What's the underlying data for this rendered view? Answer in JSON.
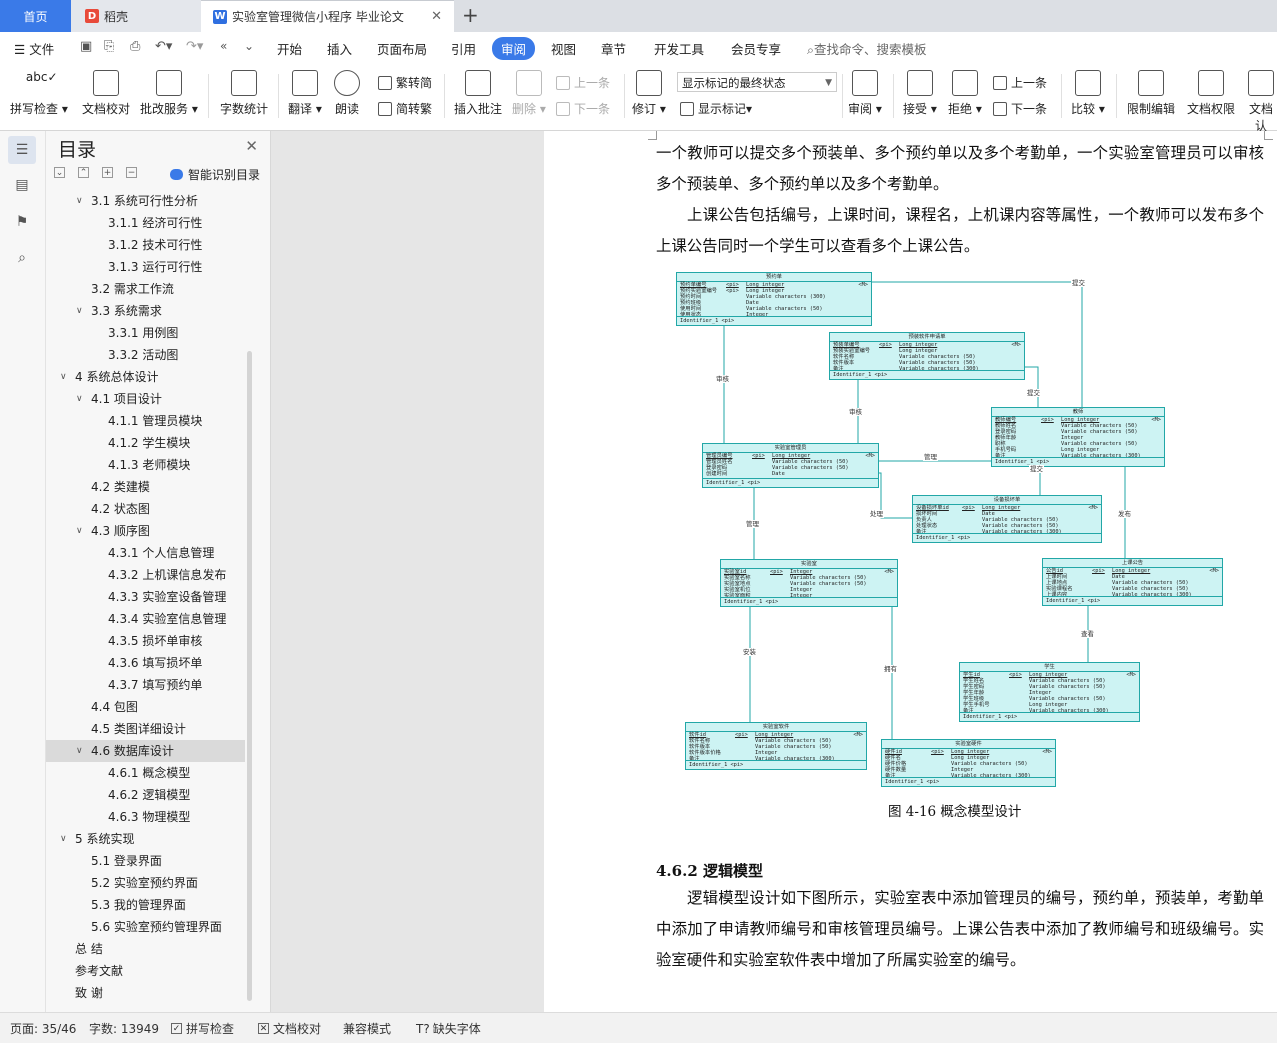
{
  "tabs": {
    "home": "首页",
    "daoke": "稻壳",
    "document": "实验室管理微信小程序 毕业论文"
  },
  "menubar": {
    "file": "文件",
    "items": [
      "开始",
      "插入",
      "页面布局",
      "引用",
      "审阅",
      "视图",
      "章节",
      "开发工具",
      "会员专享"
    ],
    "search_placeholder": "查找命令、搜索模板"
  },
  "ribbon": {
    "spell_check": "拼写检查",
    "doc_proof": "文档校对",
    "batch_service": "批改服务",
    "word_count": "字数统计",
    "translate": "翻译",
    "read_aloud": "朗读",
    "to_traditional": "繁转简",
    "to_simplified": "简转繁",
    "insert_comment": "插入批注",
    "delete": "删除",
    "prev_comment": "上一条",
    "next_comment": "下一条",
    "revise": "修订",
    "markup_mode": "显示标记的最终状态",
    "show_markup": "显示标记",
    "review": "审阅",
    "accept": "接受",
    "reject": "拒绝",
    "prev_change": "上一条",
    "next_change": "下一条",
    "compare": "比较",
    "restrict_edit": "限制编辑",
    "doc_permission": "文档权限",
    "doc_cert": "文档认"
  },
  "toc": {
    "title": "目录",
    "smart": "智能识别目录",
    "items": [
      {
        "text": "3.1 系统可行性分析",
        "level": 2,
        "expanded": true
      },
      {
        "text": "3.1.1 经济可行性",
        "level": 3
      },
      {
        "text": "3.1.2 技术可行性",
        "level": 3
      },
      {
        "text": "3.1.3 运行可行性",
        "level": 3
      },
      {
        "text": "3.2 需求工作流",
        "level": 2
      },
      {
        "text": "3.3 系统需求",
        "level": 2,
        "expanded": true
      },
      {
        "text": "3.3.1 用例图",
        "level": 3
      },
      {
        "text": "3.3.2 活动图",
        "level": 3
      },
      {
        "text": "4 系统总体设计",
        "level": 1,
        "expanded": true
      },
      {
        "text": "4.1 项目设计",
        "level": 2,
        "expanded": true
      },
      {
        "text": "4.1.1 管理员模块",
        "level": 3
      },
      {
        "text": "4.1.2 学生模块",
        "level": 3
      },
      {
        "text": "4.1.3 老师模块",
        "level": 3
      },
      {
        "text": "4.2 类建模",
        "level": 2
      },
      {
        "text": "4.2  状态图",
        "level": 2
      },
      {
        "text": "4.3  顺序图",
        "level": 2,
        "expanded": true
      },
      {
        "text": "4.3.1 个人信息管理",
        "level": 3
      },
      {
        "text": "4.3.2 上机课信息发布",
        "level": 3
      },
      {
        "text": "4.3.3 实验室设备管理",
        "level": 3
      },
      {
        "text": "4.3.4 实验室信息管理",
        "level": 3
      },
      {
        "text": "4.3.5 损坏单审核",
        "level": 3
      },
      {
        "text": "4.3.6 填写损坏单",
        "level": 3
      },
      {
        "text": "4.3.7 填写预约单",
        "level": 3
      },
      {
        "text": "4.4  包图",
        "level": 2
      },
      {
        "text": "4.5 类图详细设计",
        "level": 2
      },
      {
        "text": "4.6  数据库设计",
        "level": 2,
        "expanded": true,
        "selected": true
      },
      {
        "text": "4.6.1  概念模型",
        "level": 3
      },
      {
        "text": "4.6.2  逻辑模型",
        "level": 3
      },
      {
        "text": "4.6.3  物理模型",
        "level": 3
      },
      {
        "text": "5 系统实现",
        "level": 1,
        "expanded": true
      },
      {
        "text": "5.1 登录界面",
        "level": 2
      },
      {
        "text": "5.2  实验室预约界面",
        "level": 2
      },
      {
        "text": "5.3  我的管理界面",
        "level": 2
      },
      {
        "text": "5.6  实验室预约管理界面",
        "level": 2
      },
      {
        "text": "总   结",
        "level": 1
      },
      {
        "text": "参考文献",
        "level": 1
      },
      {
        "text": "致   谢",
        "level": 1
      }
    ]
  },
  "document": {
    "para1": "一个教师可以提交多个预装单、多个预约单以及多个考勤单，一个实验室管理员可以审核多个预装单、多个预约单以及多个考勤单。",
    "para2": "上课公告包括编号，上课时间，课程名，上机课内容等属性，一个教师可以发布多个上课公告同时一个学生可以查看多个上课公告。",
    "caption": "图 4-16  概念模型设计",
    "heading": "4.6.2  逻辑模型",
    "para3": "逻辑模型设计如下图所示，实验室表中添加管理员的编号，预约单，预装单，考勤单中添加了申请教师编号和审核管理员编号。上课公告表中添加了教师编号和班级编号。实验室硬件和实验室软件表中增加了所属实验室的编号。"
  },
  "er_diagram": {
    "entities": [
      {
        "id": "reservation",
        "title": "预约单",
        "fields": [
          [
            "预约单编号",
            "<pi>",
            "Long integer"
          ],
          [
            "预约实验室编号",
            "<pi>",
            "Long integer"
          ],
          [
            "预约时间",
            "",
            "Variable characters (300)"
          ],
          [
            "预约班级",
            "",
            "Date"
          ],
          [
            "使用时间",
            "",
            "Variable characters (50)"
          ],
          [
            "使用状态",
            "",
            "Integer"
          ]
        ],
        "identifier": "Identifier_1  <pi>",
        "mark": "<M>"
      },
      {
        "id": "preinstall",
        "title": "预装软件申请单",
        "fields": [
          [
            "预装单编号",
            "<pi>",
            "Long integer"
          ],
          [
            "预装实验室编号",
            "",
            "Long integer"
          ],
          [
            "软件名称",
            "",
            "Variable characters (50)"
          ],
          [
            "软件版本",
            "",
            "Variable characters (50)"
          ],
          [
            "备注",
            "",
            "Variable characters (300)"
          ]
        ],
        "identifier": "Identifier_1  <pi>",
        "mark": "<M>"
      },
      {
        "id": "teacher",
        "title": "教师",
        "fields": [
          [
            "教师编号",
            "<pi>",
            "Long integer"
          ],
          [
            "教师姓名",
            "",
            "Variable characters (50)"
          ],
          [
            "登录密码",
            "",
            "Variable characters (50)"
          ],
          [
            "教师年龄",
            "",
            "Integer"
          ],
          [
            "职称",
            "",
            "Variable characters (50)"
          ],
          [
            "手机号码",
            "",
            "Long integer"
          ],
          [
            "备注",
            "",
            "Variable characters (300)"
          ]
        ],
        "identifier": "Identifier_1  <pi>",
        "mark": "<M>"
      },
      {
        "id": "admin",
        "title": "实验室管理员",
        "fields": [
          [
            "管理员编号",
            "<pi>",
            "Long integer"
          ],
          [
            "管理员姓名",
            "",
            "Variable characters (50)"
          ],
          [
            "登录密码",
            "",
            "Variable characters (50)"
          ],
          [
            "创建时间",
            "",
            "Date"
          ]
        ],
        "identifier": "Identifier_1  <pi>",
        "mark": "<M>"
      },
      {
        "id": "damage",
        "title": "设备损坏单",
        "fields": [
          [
            "设备损坏单id",
            "<pi>",
            "Long integer"
          ],
          [
            "损坏时间",
            "",
            "Date"
          ],
          [
            "负责人",
            "",
            "Variable characters (50)"
          ],
          [
            "处理状态",
            "",
            "Variable characters (50)"
          ],
          [
            "备注",
            "",
            "Variable characters (300)"
          ]
        ],
        "identifier": "Identifier_1  <pi>",
        "mark": "<M>"
      },
      {
        "id": "lab",
        "title": "实验室",
        "fields": [
          [
            "实验室id",
            "<pi>",
            "Integer"
          ],
          [
            "实验室名称",
            "",
            "Variable characters (50)"
          ],
          [
            "实验室地点",
            "",
            "Variable characters (50)"
          ],
          [
            "实验室机位",
            "",
            "Integer"
          ],
          [
            "实验室面积",
            "",
            "Integer"
          ]
        ],
        "identifier": "Identifier_1  <pi>",
        "mark": "<M>"
      },
      {
        "id": "notice",
        "title": "上课公告",
        "fields": [
          [
            "公告id",
            "<pi>",
            "Long integer"
          ],
          [
            "上课时间",
            "",
            "Date"
          ],
          [
            "上课地点",
            "",
            "Variable characters (50)"
          ],
          [
            "实验课程名",
            "",
            "Variable characters (50)"
          ],
          [
            "上课内容",
            "",
            "Variable characters (300)"
          ]
        ],
        "identifier": "Identifier_1  <pi>",
        "mark": "<M>"
      },
      {
        "id": "student",
        "title": "学生",
        "fields": [
          [
            "学生id",
            "<pi>",
            "Long integer"
          ],
          [
            "学生姓名",
            "",
            "Variable characters (50)"
          ],
          [
            "学生密码",
            "",
            "Variable characters (50)"
          ],
          [
            "学生年龄",
            "",
            "Integer"
          ],
          [
            "学生班级",
            "",
            "Variable characters (50)"
          ],
          [
            "学生手机号",
            "",
            "Long integer"
          ],
          [
            "备注",
            "",
            "Variable characters (300)"
          ]
        ],
        "identifier": "Identifier_1  <pi>",
        "mark": "<M>"
      },
      {
        "id": "software",
        "title": "实验室软件",
        "fields": [
          [
            "软件id",
            "<pi>",
            "Long integer"
          ],
          [
            "软件名称",
            "",
            "Variable characters (50)"
          ],
          [
            "软件版本",
            "",
            "Variable characters (50)"
          ],
          [
            "软件版本价格",
            "",
            "Integer"
          ],
          [
            "备注",
            "",
            "Variable characters (300)"
          ]
        ],
        "identifier": "Identifier_1  <pi>",
        "mark": "<M>"
      },
      {
        "id": "hardware",
        "title": "实验室硬件",
        "fields": [
          [
            "硬件id",
            "<pi>",
            "Long integer"
          ],
          [
            "硬件名",
            "",
            "Long integer"
          ],
          [
            "硬件价格",
            "",
            "Variable characters (50)"
          ],
          [
            "硬件数量",
            "",
            "Integer"
          ],
          [
            "备注",
            "",
            "Variable characters (300)"
          ]
        ],
        "identifier": "Identifier_1  <pi>",
        "mark": "<M>"
      }
    ],
    "relations": [
      "提交",
      "审核",
      "审核",
      "提交",
      "管理",
      "提交",
      "管理",
      "处理",
      "发布",
      "查看",
      "安装",
      "拥有"
    ]
  },
  "statusbar": {
    "page": "页面: 35/46",
    "words": "字数: 13949",
    "spell": "拼写检查",
    "proof": "文档校对",
    "compat": "兼容模式",
    "missing_font": "缺失字体"
  }
}
